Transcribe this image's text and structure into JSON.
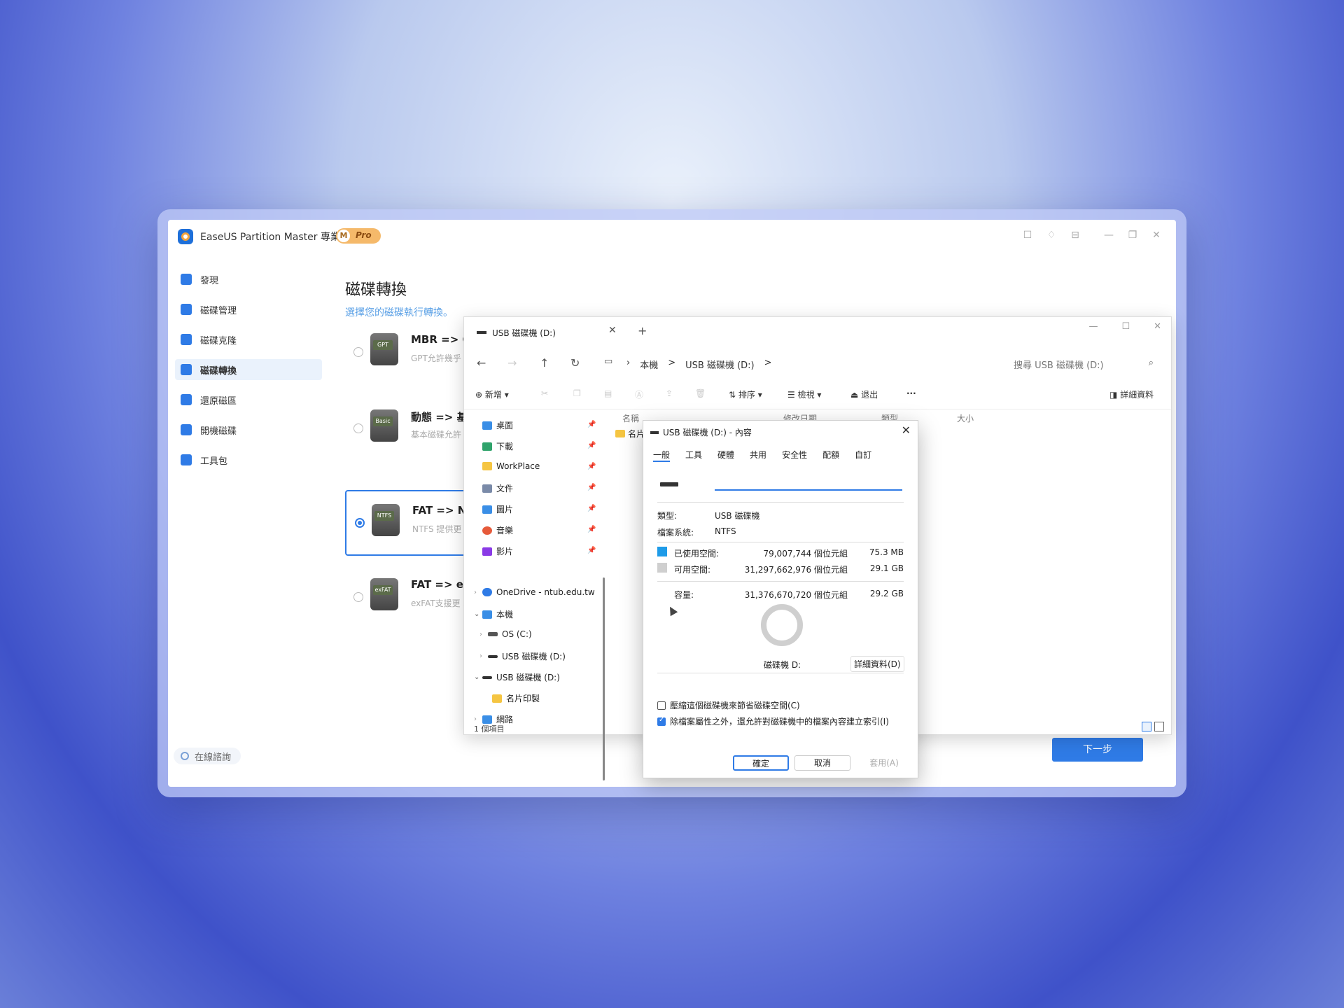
{
  "app": {
    "title": "EaseUS Partition Master 專業版",
    "pro_m": "M",
    "pro_label": "Pro",
    "icons": [
      "feedback-icon",
      "skin-icon",
      "settings-icon",
      "minimize-icon",
      "maximize-icon",
      "close-icon"
    ],
    "icon_glyphs": [
      "☐",
      "♢",
      "⊟",
      "—",
      "❐",
      "✕"
    ]
  },
  "sidebar": {
    "items": [
      {
        "label": "發現",
        "icon": "discover-icon"
      },
      {
        "label": "磁碟管理",
        "icon": "disk-manage-icon"
      },
      {
        "label": "磁碟克隆",
        "icon": "disk-clone-icon"
      },
      {
        "label": "磁碟轉換",
        "icon": "disk-convert-icon",
        "active": true
      },
      {
        "label": "還原磁區",
        "icon": "restore-icon"
      },
      {
        "label": "開機磁碟",
        "icon": "boot-disk-icon"
      },
      {
        "label": "工具包",
        "icon": "toolkit-icon"
      }
    ],
    "online_help": "在線諮詢"
  },
  "main": {
    "title": "磁碟轉換",
    "subtitle": "選擇您的磁碟執行轉換。",
    "options": [
      {
        "title": "MBR => GPT",
        "desc": "GPT允許幾乎 分區類型",
        "disk_label": "GPT"
      },
      {
        "title": "動態 => 基本",
        "desc": "基本磁碟允許 Windows作業",
        "disk_label": "Basic"
      },
      {
        "title": "FAT => NTFS",
        "desc": "NTFS 提供更 表和分割區大",
        "disk_label": "NTFS",
        "selected": true
      },
      {
        "title": "FAT => exFAT",
        "desc": "exFAT支援更 和Windows之",
        "disk_label": "exFAT"
      }
    ],
    "next_label": "下一步"
  },
  "explorer": {
    "tab_title": "USB 磁碟機 (D:)",
    "tab_close": "✕",
    "tab_add": "+",
    "win_controls": [
      "—",
      "☐",
      "✕"
    ],
    "breadcrumbs": [
      "本機",
      ">",
      "USB 磁碟機 (D:)",
      ">"
    ],
    "search_placeholder": "搜尋 USB 磁碟機 (D:)",
    "toolbar": {
      "new": "新增",
      "sort": "排序",
      "view": "檢視",
      "eject": "退出",
      "more": "···",
      "details": "詳細資料"
    },
    "columns": [
      "名稱",
      "修改日期",
      "類型",
      "大小"
    ],
    "nav_items": [
      {
        "label": "桌面",
        "pinned": true,
        "color": "#3a8ee6"
      },
      {
        "label": "下載",
        "pinned": true,
        "color": "#2fa36b"
      },
      {
        "label": "WorkPlace",
        "pinned": true,
        "color": "#f5c542"
      },
      {
        "label": "文件",
        "pinned": true,
        "color": "#7a8aa8"
      },
      {
        "label": "圖片",
        "pinned": true,
        "color": "#3a8ee6"
      },
      {
        "label": "音樂",
        "pinned": true,
        "color": "#e65a3a"
      },
      {
        "label": "影片",
        "pinned": true,
        "color": "#8a3ae6"
      },
      {
        "label": "OneDrive - ntub.edu.tw",
        "color": "#2f7be6"
      },
      {
        "label": "本機",
        "color": "#3a8ee6"
      },
      {
        "label": "OS (C:)",
        "color": "#555555"
      },
      {
        "label": "USB 磁碟機 (D:)",
        "color": "#333333"
      },
      {
        "label": "USB 磁碟機 (D:)",
        "color": "#333333"
      },
      {
        "label": "名片印製",
        "color": "#f5c542"
      },
      {
        "label": "網路",
        "color": "#3a8ee6"
      }
    ],
    "file_name": "名片",
    "status": "1 個項目"
  },
  "properties": {
    "title": "USB 磁碟機 (D:) - 內容",
    "tabs": [
      "一般",
      "工具",
      "硬體",
      "共用",
      "安全性",
      "配額",
      "自訂"
    ],
    "type_label": "類型:",
    "type_value": "USB 磁碟機",
    "fs_label": "檔案系統:",
    "fs_value": "NTFS",
    "used_label": "已使用空間:",
    "used_bytes": "79,007,744 個位元組",
    "used_size": "75.3 MB",
    "free_label": "可用空間:",
    "free_bytes": "31,297,662,976 個位元組",
    "free_size": "29.1 GB",
    "capacity_label": "容量:",
    "capacity_bytes": "31,376,670,720 個位元組",
    "capacity_size": "29.2 GB",
    "drive_label": "磁碟機 D:",
    "details_button": "詳細資料(D)",
    "compress_label": "壓縮這個磁碟機來節省磁碟空間(C)",
    "index_label": "除檔案屬性之外，還允許對磁碟機中的檔案內容建立索引(I)",
    "ok": "確定",
    "cancel": "取消",
    "apply": "套用(A)",
    "colors": {
      "used": "#1e9be8",
      "free": "#cfcfcf"
    }
  }
}
